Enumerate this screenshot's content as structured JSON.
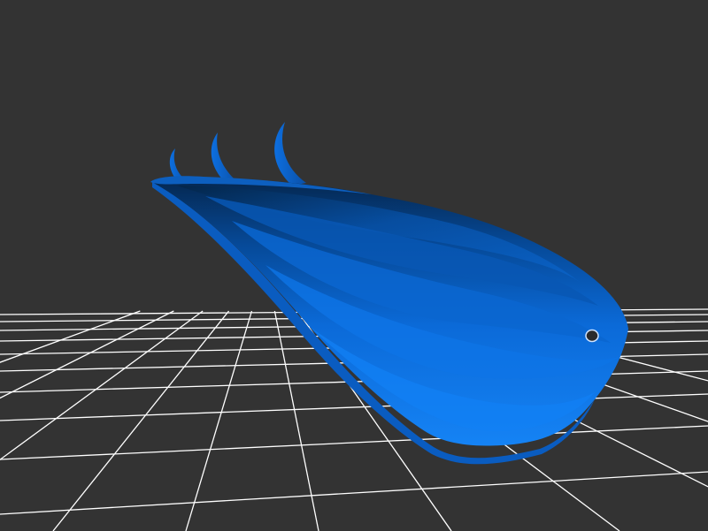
{
  "viewer": {
    "background_color": "#333333",
    "grid_color": "#ffffff",
    "model_color": "#0a6fe0",
    "model_shadow_color": "#06356e",
    "model_highlight_color": "#1a86ff"
  },
  "model": {
    "name": "",
    "spike_count": 3,
    "has_hole": true
  }
}
